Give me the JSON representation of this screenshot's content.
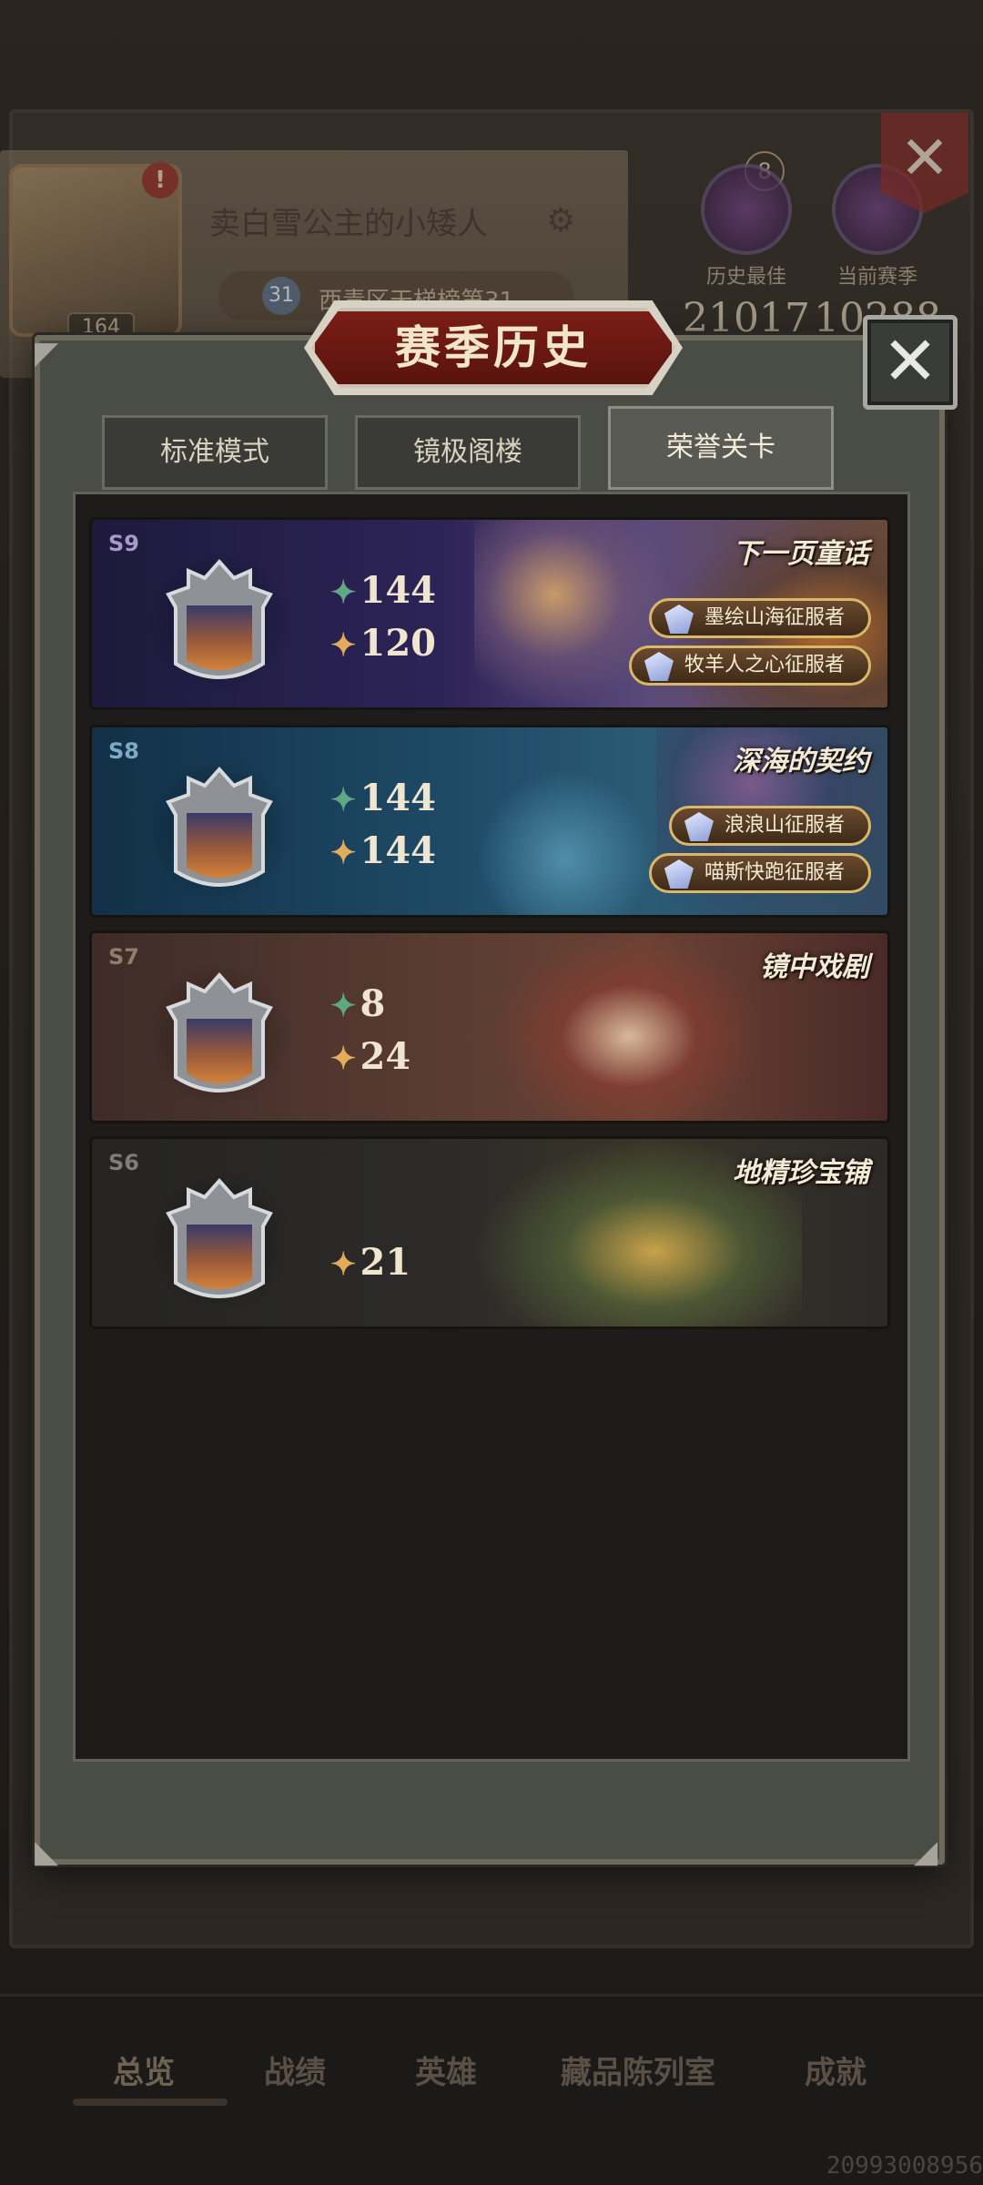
{
  "background": {
    "username": "卖白雪公主的小矮人",
    "avatar_level": "164",
    "alert_badge": "!",
    "rank_number": "31",
    "rank_text": "西青区天梯榜第31",
    "crown_count": "8",
    "stats": [
      {
        "label": "历史最佳",
        "value": "21017"
      },
      {
        "label": "当前赛季",
        "value": "10288"
      }
    ],
    "close_symbol": "✕"
  },
  "modal": {
    "title": "赛季历史",
    "close_symbol": "✕",
    "tabs": [
      {
        "label": "标准模式",
        "active": false
      },
      {
        "label": "镜极阁楼",
        "active": false
      },
      {
        "label": "荣誉关卡",
        "active": true
      }
    ],
    "seasons": [
      {
        "id": "S9",
        "name": "下一页童话",
        "stat_green": "144",
        "stat_gold": "120",
        "badges": [
          "墨绘山海征服者",
          "牧羊人之心征服者"
        ]
      },
      {
        "id": "S8",
        "name": "深海的契约",
        "stat_green": "144",
        "stat_gold": "144",
        "badges": [
          "浪浪山征服者",
          "喵斯快跑征服者"
        ]
      },
      {
        "id": "S7",
        "name": "镜中戏剧",
        "stat_green": "8",
        "stat_gold": "24",
        "badges": []
      },
      {
        "id": "S6",
        "name": "地精珍宝铺",
        "stat_green": "",
        "stat_gold": "21",
        "badges": []
      }
    ]
  },
  "bottom_nav": {
    "items": [
      "总览",
      "战绩",
      "英雄",
      "藏品陈列室",
      "成就"
    ],
    "active_index": 0
  },
  "footer": {
    "uid": "20993008956"
  },
  "colors": {
    "accent_gold": "#e2ac5a",
    "accent_green": "#5ea884",
    "title_red": "#7a1e16"
  }
}
